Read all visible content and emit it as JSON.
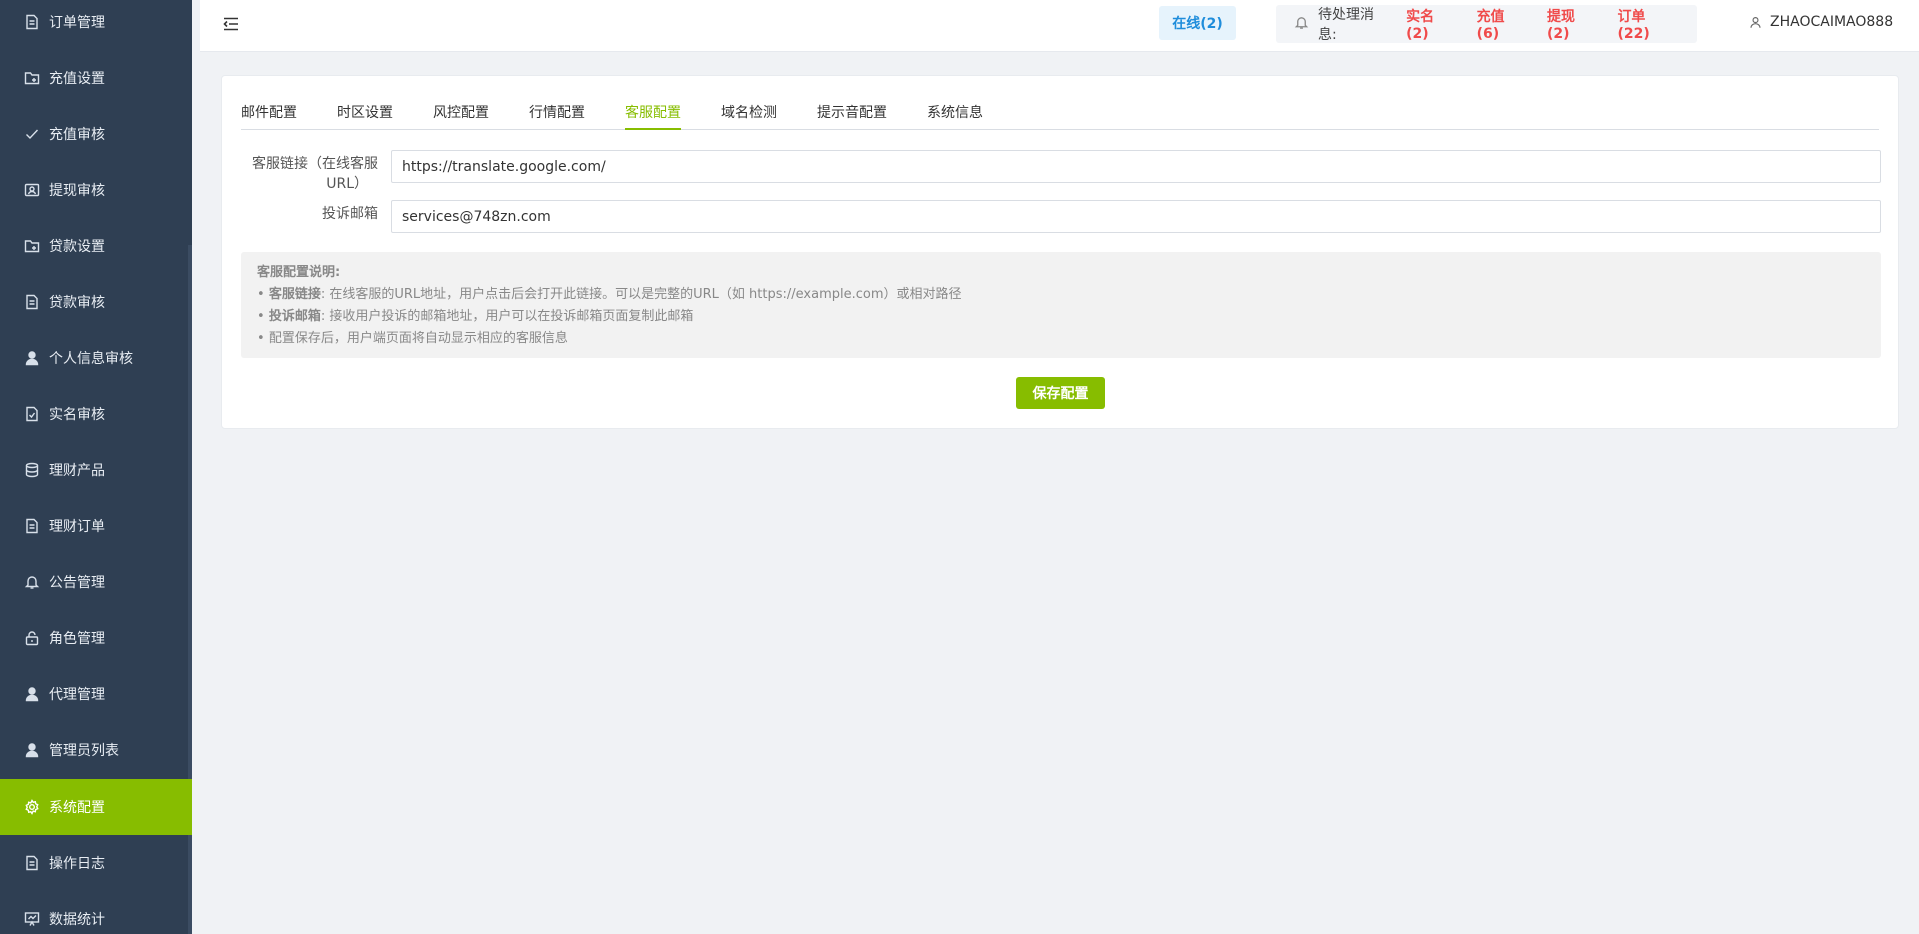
{
  "sidebar": {
    "items": [
      {
        "label": "订单管理",
        "icon": "document-icon"
      },
      {
        "label": "充值设置",
        "icon": "folder-icon"
      },
      {
        "label": "充值审核",
        "icon": "check-icon"
      },
      {
        "label": "提现审核",
        "icon": "id-card-icon"
      },
      {
        "label": "贷款设置",
        "icon": "folder-icon"
      },
      {
        "label": "贷款审核",
        "icon": "document-icon"
      },
      {
        "label": "个人信息审核",
        "icon": "user-icon"
      },
      {
        "label": "实名审核",
        "icon": "document-check-icon"
      },
      {
        "label": "理财产品",
        "icon": "database-icon"
      },
      {
        "label": "理财订单",
        "icon": "document-icon"
      },
      {
        "label": "公告管理",
        "icon": "bell-icon"
      },
      {
        "label": "角色管理",
        "icon": "lock-icon"
      },
      {
        "label": "代理管理",
        "icon": "user-icon"
      },
      {
        "label": "管理员列表",
        "icon": "user-icon"
      },
      {
        "label": "系统配置",
        "icon": "gear-icon",
        "active": true
      },
      {
        "label": "操作日志",
        "icon": "document-icon"
      },
      {
        "label": "数据统计",
        "icon": "chart-icon"
      }
    ]
  },
  "header": {
    "online": "在线(2)",
    "notice_label": "待处理消息:",
    "notices": [
      "实名(2)",
      "充值(6)",
      "提现(2)",
      "订单(22)"
    ],
    "username": "ZHAOCAIMAO888"
  },
  "tabs": [
    {
      "label": "邮件配置"
    },
    {
      "label": "时区设置"
    },
    {
      "label": "风控配置"
    },
    {
      "label": "行情配置"
    },
    {
      "label": "客服配置",
      "active": true
    },
    {
      "label": "域名检测"
    },
    {
      "label": "提示音配置"
    },
    {
      "label": "系统信息"
    }
  ],
  "form": {
    "service_link_label_line1": "客服链接（在线客服",
    "service_link_label_line2": "URL）",
    "service_link_value": "https://translate.google.com/",
    "complaint_email_label": "投诉邮箱",
    "complaint_email_value": "services@748zn.com"
  },
  "info": {
    "title": "客服配置说明:",
    "line1_key": "客服链接",
    "line1_text": "在线客服的URL地址，用户点击后会打开此链接。可以是完整的URL（如 https://example.com）或相对路径",
    "line2_key": "投诉邮箱",
    "line2_text": "接收用户投诉的邮箱地址，用户可以在投诉邮箱页面复制此邮箱",
    "line3_text": "配置保存后，用户端页面将自动显示相应的客服信息"
  },
  "save_label": "保存配置",
  "colors": {
    "sidebar_bg": "#2f3f53",
    "accent": "#87bd00",
    "alert_red": "#f04b4b",
    "online_blue": "#1f8ddb"
  }
}
